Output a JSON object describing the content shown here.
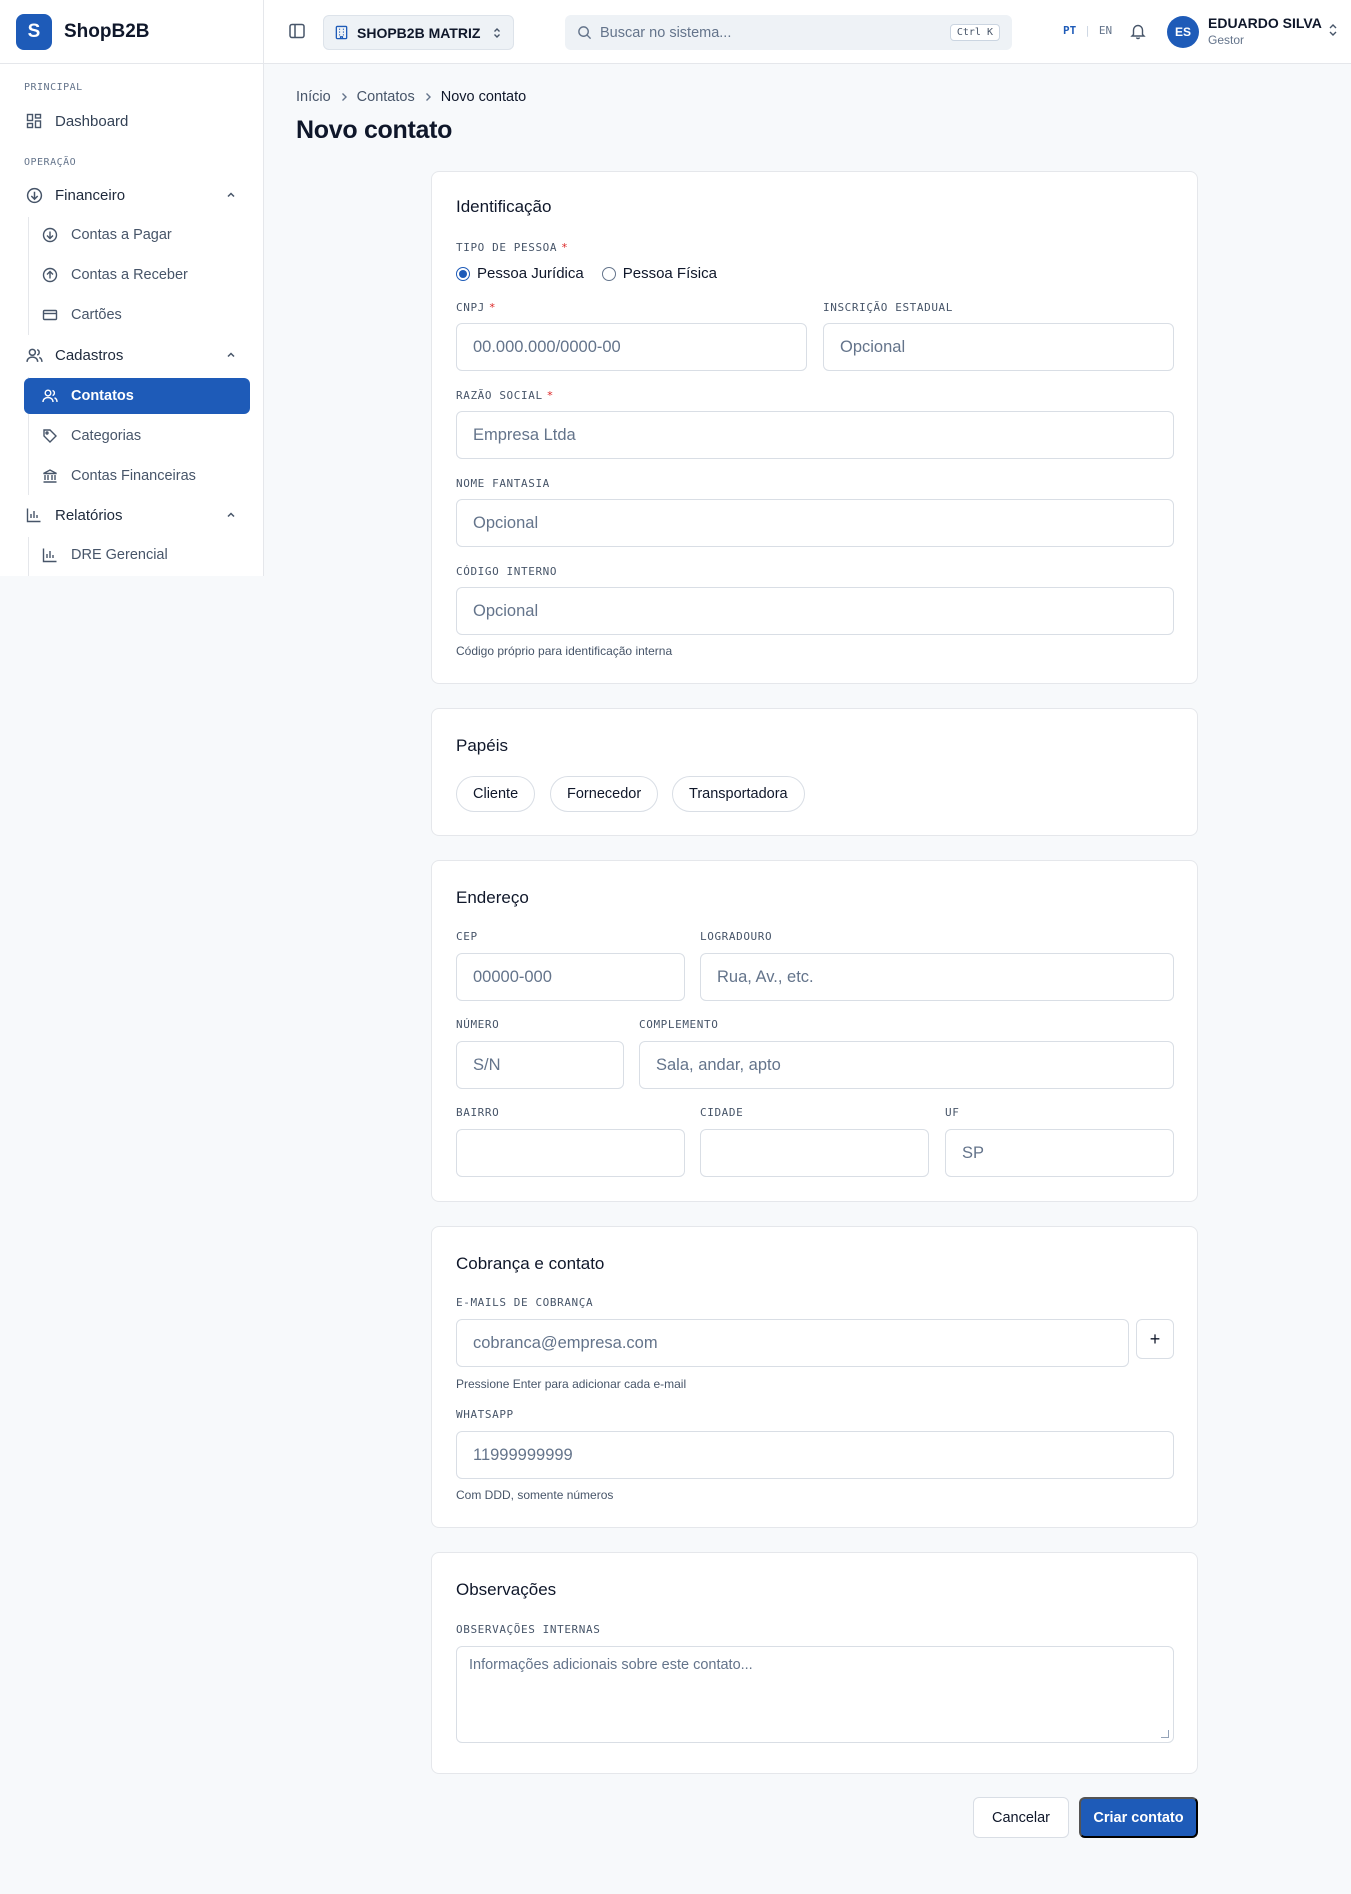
{
  "brand": {
    "logo_letter": "S",
    "name": "ShopB2B"
  },
  "sidebar": {
    "sections": [
      "PRINCIPAL",
      "OPERAÇÃO"
    ],
    "dashboard": "Dashboard",
    "financeiro": {
      "label": "Financeiro",
      "items": [
        "Contas a Pagar",
        "Contas a Receber",
        "Cartões"
      ]
    },
    "cadastros": {
      "label": "Cadastros",
      "items": [
        "Contatos",
        "Categorias",
        "Contas Financeiras"
      ]
    },
    "relatorios": {
      "label": "Relatórios",
      "items": [
        "DRE Gerencial"
      ]
    },
    "active_item": "Contatos"
  },
  "header": {
    "company": "SHOPB2B MATRIZ",
    "search_placeholder": "Buscar no sistema...",
    "search_shortcut": "Ctrl K",
    "lang_active": "PT",
    "lang_other": "EN",
    "user_initials": "ES",
    "user_name": "EDUARDO SILVA",
    "user_role": "Gestor"
  },
  "breadcrumb": [
    "Início",
    "Contatos",
    "Novo contato"
  ],
  "page_title": "Novo contato",
  "identificacao": {
    "title": "Identificação",
    "tipo_label": "TIPO DE PESSOA",
    "tipo_options": [
      "Pessoa Jurídica",
      "Pessoa Física"
    ],
    "tipo_selected": "Pessoa Jurídica",
    "cnpj_label": "CNPJ",
    "cnpj_placeholder": "00.000.000/0000-00",
    "ie_label": "INSCRIÇÃO ESTADUAL",
    "ie_placeholder": "Opcional",
    "razao_label": "RAZÃO SOCIAL",
    "razao_placeholder": "Empresa Ltda",
    "fantasia_label": "NOME FANTASIA",
    "fantasia_placeholder": "Opcional",
    "codigo_label": "CÓDIGO INTERNO",
    "codigo_placeholder": "Opcional",
    "codigo_helper": "Código próprio para identificação interna"
  },
  "papeis": {
    "title": "Papéis",
    "chips": [
      "Cliente",
      "Fornecedor",
      "Transportadora"
    ]
  },
  "endereco": {
    "title": "Endereço",
    "cep_label": "CEP",
    "cep_placeholder": "00000-000",
    "logradouro_label": "LOGRADOURO",
    "logradouro_placeholder": "Rua, Av., etc.",
    "numero_label": "NÚMERO",
    "numero_placeholder": "S/N",
    "complemento_label": "COMPLEMENTO",
    "complemento_placeholder": "Sala, andar, apto",
    "bairro_label": "BAIRRO",
    "bairro_placeholder": "",
    "cidade_label": "CIDADE",
    "cidade_placeholder": "",
    "uf_label": "UF",
    "uf_placeholder": "SP"
  },
  "cobranca": {
    "title": "Cobrança e contato",
    "emails_label": "E-MAILS DE COBRANÇA",
    "emails_placeholder": "cobranca@empresa.com",
    "add_symbol": "+",
    "emails_helper": "Pressione Enter para adicionar cada e-mail",
    "whatsapp_label": "WHATSAPP",
    "whatsapp_placeholder": "11999999999",
    "whatsapp_helper": "Com DDD, somente números"
  },
  "observacoes": {
    "title": "Observações",
    "label": "OBSERVAÇÕES INTERNAS",
    "placeholder": "Informações adicionais sobre este contato..."
  },
  "actions": {
    "cancel": "Cancelar",
    "create": "Criar contato"
  },
  "colors": {
    "primary": "#1e5bb8",
    "required": "#dc2626",
    "background": "#f7f9fb"
  }
}
